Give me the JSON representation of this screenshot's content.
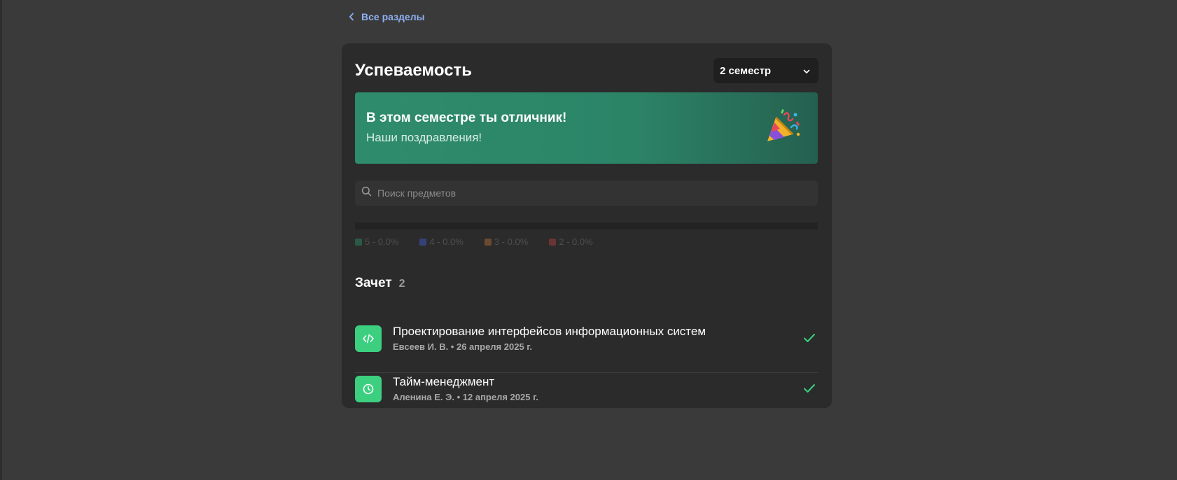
{
  "nav": {
    "back_label": "Все разделы"
  },
  "header": {
    "title": "Успеваемость",
    "semester_value": "2 семестр"
  },
  "banner": {
    "title": "В этом семестре ты отличник!",
    "subtitle": "Наши поздравления!"
  },
  "search": {
    "placeholder": "Поиск предметов",
    "value": ""
  },
  "grades": {
    "distribution": [
      {
        "grade": "5",
        "percent": 0.0,
        "label": "5 - 0.0%",
        "color": "#2a5a46"
      },
      {
        "grade": "4",
        "percent": 0.0,
        "label": "4 - 0.0%",
        "color": "#35427a"
      },
      {
        "grade": "3",
        "percent": 0.0,
        "label": "3 - 0.0%",
        "color": "#6b4a30"
      },
      {
        "grade": "2",
        "percent": 0.0,
        "label": "2 - 0.0%",
        "color": "#6b3434"
      }
    ]
  },
  "section": {
    "name": "Зачет",
    "count": "2",
    "subjects": [
      {
        "name": "Проектирование интерфейсов информационных систем",
        "meta": "Евсеев И. В. • 26 апреля 2025 г.",
        "icon": "code-icon",
        "status": "passed"
      },
      {
        "name": "Тайм-менеджмент",
        "meta": "Аленина Е. Э. • 12 апреля 2025 г.",
        "icon": "clock-icon",
        "status": "passed"
      }
    ]
  },
  "colors": {
    "background": "#3a3a3a",
    "panel": "#2b2b2b",
    "accent_link": "#8fb0f2",
    "banner": "#2e8c6c",
    "subject_icon": "#3bcf7f",
    "check": "#3bcf7f"
  }
}
